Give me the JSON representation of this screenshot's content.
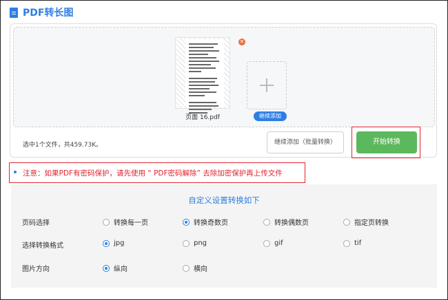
{
  "header": {
    "title": "PDF转长图",
    "icon": "document-icon"
  },
  "upload": {
    "file": {
      "name": "页面 16.pdf"
    },
    "add_more_label": "继续添加",
    "summary": "选中1个文件，共459.73K。",
    "batch_button": "继续添加（批量转换）",
    "start_button": "开始转换"
  },
  "notice": {
    "text": "注意：如果PDF有密码保护，请先使用  “ PDF密码解除”   去除加密保护再上传文件"
  },
  "settings": {
    "title": "自定义设置转换如下",
    "page_select": {
      "label": "页码选择",
      "options": [
        "转换每一页",
        "转换奇数页",
        "转换偶数页",
        "指定页转换"
      ],
      "selected": "转换奇数页"
    },
    "format": {
      "label": "选择转换格式",
      "options": [
        "jpg",
        "png",
        "gif",
        "tif"
      ],
      "selected": "jpg"
    },
    "orientation": {
      "label": "图片方向",
      "options": [
        "纵向",
        "横向"
      ],
      "selected": "纵向"
    }
  },
  "colors": {
    "accent": "#2d7fe3",
    "start": "#5cb85c",
    "warning": "#e3232f"
  }
}
